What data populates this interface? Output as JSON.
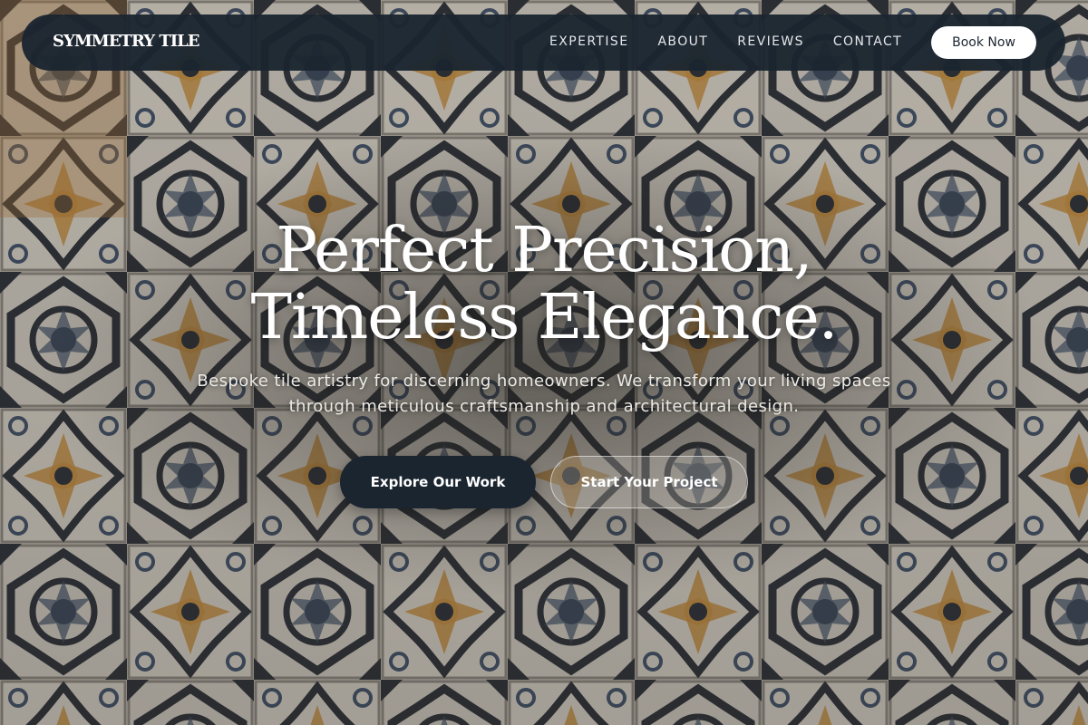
{
  "brand": {
    "name": "SYMMETRY TILE"
  },
  "nav": {
    "links": [
      {
        "label": "EXPERTISE"
      },
      {
        "label": "ABOUT"
      },
      {
        "label": "REVIEWS"
      },
      {
        "label": "CONTACT"
      }
    ],
    "cta_label": "Book Now"
  },
  "hero": {
    "title_line1": "Perfect Precision,",
    "title_line2": "Timeless Elegance.",
    "subtitle_line1": "Bespoke tile artistry for discerning homeowners. We transform your living spaces",
    "subtitle_line2": "through meticulous craftsmanship and architectural design.",
    "primary_cta": "Explore Our Work",
    "secondary_cta": "Start Your Project"
  },
  "colors": {
    "nav_bg": "#1b2530",
    "accent_dark": "#1b2530",
    "text_light": "#ffffff",
    "tile_ink": "#2b2f36",
    "tile_ochre": "#c08a3e",
    "tile_blue": "#3f4f66"
  }
}
